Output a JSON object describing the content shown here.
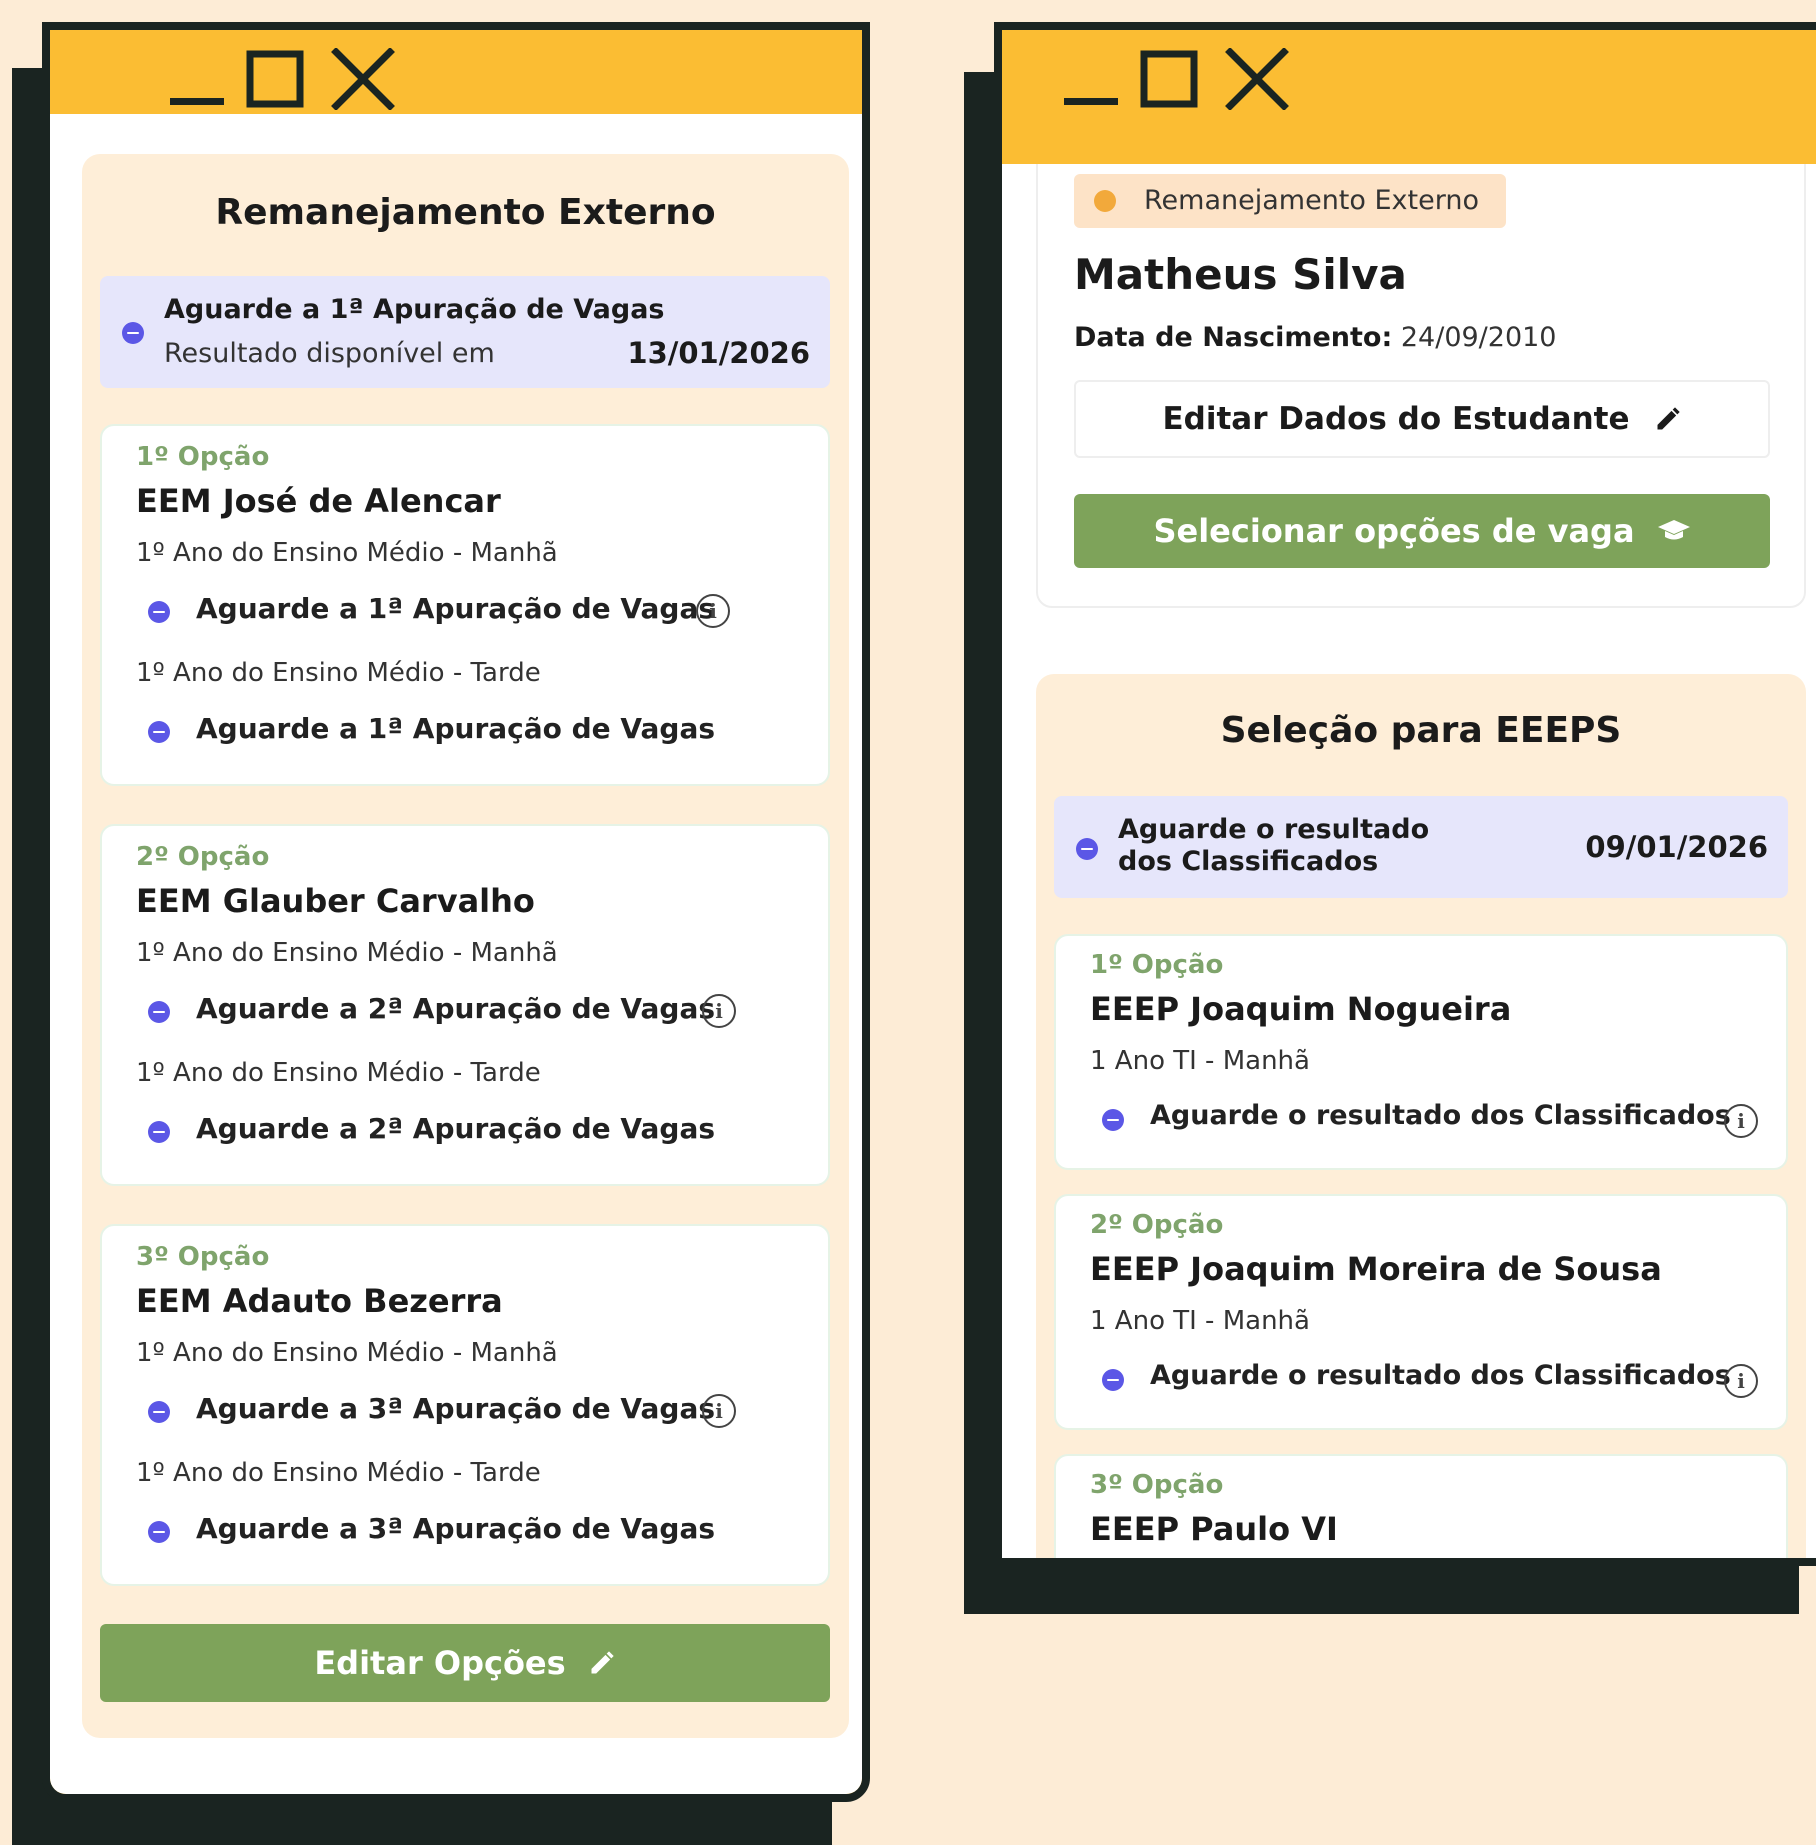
{
  "left_window": {
    "panel_title": "Remanejamento Externo",
    "notice": {
      "title": "Aguarde a 1ª Apuração de Vagas",
      "subtitle": "Resultado disponível em",
      "date": "13/01/2026"
    },
    "options": [
      {
        "label": "1º Opção",
        "school": "EEM José de Alencar",
        "shift1": "1º Ano do Ensino Médio - Manhã",
        "status1": "Aguarde a 1ª Apuração de Vagas",
        "shift2": "1º Ano do Ensino Médio - Tarde",
        "status2": "Aguarde a 1ª Apuração de Vagas"
      },
      {
        "label": "2º Opção",
        "school": "EEM Glauber Carvalho",
        "shift1": "1º Ano do Ensino Médio - Manhã",
        "status1": "Aguarde a 2ª Apuração de Vagas",
        "shift2": "1º Ano do Ensino Médio - Tarde",
        "status2": "Aguarde a 2ª Apuração de Vagas"
      },
      {
        "label": "3º Opção",
        "school": "EEM Adauto Bezerra",
        "shift1": "1º Ano do Ensino Médio - Manhã",
        "status1": "Aguarde a 3ª Apuração de Vagas",
        "shift2": "1º Ano do Ensino Médio - Tarde",
        "status2": "Aguarde a 3ª Apuração de Vagas"
      }
    ],
    "edit_button": "Editar Opções"
  },
  "right_window": {
    "tag": "Remanejamento Externo",
    "student_name": "Matheus Silva",
    "birth_label": "Data de Nascimento:",
    "birth_value": "24/09/2010",
    "edit_student_button": "Editar Dados do Estudante",
    "select_button": "Selecionar opções de vaga",
    "panel_title": "Seleção para EEEPS",
    "notice": {
      "title": "Aguarde o resultado dos Classificados",
      "date": "09/01/2026"
    },
    "options": [
      {
        "label": "1º Opção",
        "school": "EEEP Joaquim Nogueira",
        "shift": "1 Ano TI - Manhã",
        "status": "Aguarde o resultado dos Classificados"
      },
      {
        "label": "2º Opção",
        "school": "EEEP Joaquim Moreira de Sousa",
        "shift": "1 Ano TI - Manhã",
        "status": "Aguarde o resultado dos Classificados"
      },
      {
        "label": "3º Opção",
        "school": "EEEP Paulo VI"
      }
    ]
  },
  "icons": [
    "minimize-icon",
    "maximize-icon",
    "close-icon",
    "pencil-icon",
    "graduation-cap-icon",
    "info-icon",
    "status-dot-icon"
  ],
  "colors": {
    "background": "#fdecd6",
    "title_bar": "#fbbd33",
    "frame": "#1a2421",
    "panel": "#feeed8",
    "notice": "#e6e6fb",
    "accent_green": "#7ea35a",
    "status_dot": "#5b57e6",
    "option_label": "#7fa46c",
    "tag_bg": "#fde3c7",
    "tag_dot": "#f2a93b"
  }
}
